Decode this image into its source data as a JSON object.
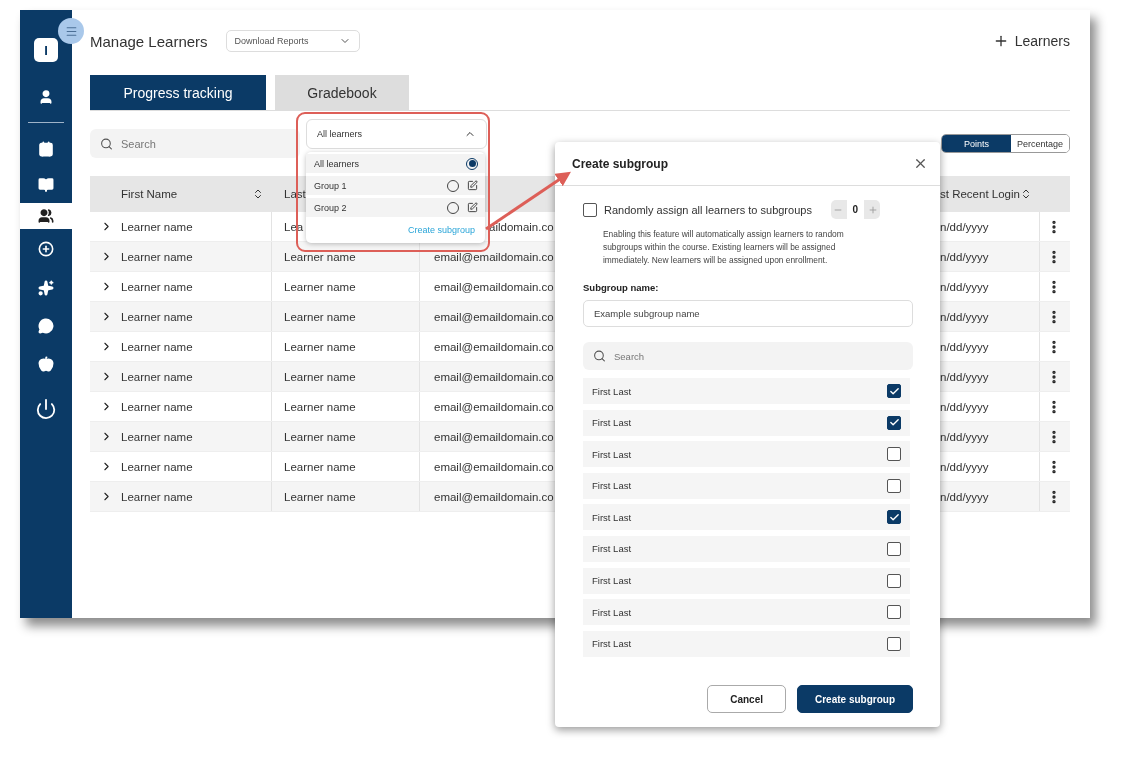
{
  "sidebar": {
    "logo": "I",
    "items": [
      {
        "selected": false
      },
      {
        "selected": false
      },
      {
        "selected": false
      },
      {
        "selected": true
      },
      {
        "selected": false
      },
      {
        "selected": false
      },
      {
        "selected": false
      },
      {
        "selected": false
      },
      {
        "selected": false
      }
    ]
  },
  "header": {
    "title": "Manage Learners",
    "reports_select": "Download Reports",
    "add_button": "Learners"
  },
  "tabs": [
    {
      "label": "Progress tracking",
      "selected": true
    },
    {
      "label": "Gradebook",
      "selected": false
    }
  ],
  "search": {
    "placeholder": "Search"
  },
  "filter": {
    "value": "All learners",
    "expanded": true,
    "options": [
      {
        "label": "All learners",
        "selected": true,
        "editable": false
      },
      {
        "label": "Group 1",
        "selected": false,
        "editable": true
      },
      {
        "label": "Group 2",
        "selected": false,
        "editable": true
      }
    ],
    "action": "Create subgroup"
  },
  "score_toggle": [
    {
      "label": "Points",
      "selected": true
    },
    {
      "label": "Percentage",
      "selected": false
    }
  ],
  "table": {
    "columns": [
      {
        "label": "First Name",
        "sortable": true
      },
      {
        "label": "Last",
        "sortable": false
      },
      {
        "sortable": false
      },
      {
        "label": "st Recent Login",
        "sortable": true
      }
    ],
    "rows": [
      {
        "expanded": false,
        "cells": [
          "Learner name",
          "Lea",
          "aildomain.co",
          "n/dd/yyyy"
        ]
      },
      {
        "expanded": false,
        "cells": [
          "Learner name",
          "Learner name",
          "email@emaildomain.co",
          "n/dd/yyyy"
        ]
      },
      {
        "expanded": false,
        "cells": [
          "Learner name",
          "Learner name",
          "email@emaildomain.co",
          "n/dd/yyyy"
        ]
      },
      {
        "expanded": false,
        "cells": [
          "Learner name",
          "Learner name",
          "email@emaildomain.co",
          "n/dd/yyyy"
        ]
      },
      {
        "expanded": false,
        "cells": [
          "Learner name",
          "Learner name",
          "email@emaildomain.co",
          "n/dd/yyyy"
        ]
      },
      {
        "expanded": false,
        "cells": [
          "Learner name",
          "Learner name",
          "email@emaildomain.co",
          "n/dd/yyyy"
        ]
      },
      {
        "expanded": false,
        "cells": [
          "Learner name",
          "Learner name",
          "email@emaildomain.co",
          "n/dd/yyyy"
        ]
      },
      {
        "expanded": false,
        "cells": [
          "Learner name",
          "Learner name",
          "email@emaildomain.co",
          "n/dd/yyyy"
        ]
      },
      {
        "expanded": false,
        "cells": [
          "Learner name",
          "Learner name",
          "email@emaildomain.co",
          "n/dd/yyyy"
        ]
      },
      {
        "expanded": false,
        "cells": [
          "Learner name",
          "Learner name",
          "email@emaildomain.co",
          "n/dd/yyyy"
        ]
      }
    ]
  },
  "dialog": {
    "title": "Create subgroup",
    "random_assign": {
      "label": "Randomly assign all learners to subgroups",
      "checked": false,
      "count": "0",
      "help": "Enabling this feature will automatically assign learners to random subgroups within the course. Existing learners will be assigned immediately. New learners will be assigned upon enrollment."
    },
    "name_label": "Subgroup name:",
    "name_placeholder": "Example subgroup name",
    "search_placeholder": "Search",
    "learners": [
      {
        "name": "First Last",
        "checked": true
      },
      {
        "name": "First Last",
        "checked": true
      },
      {
        "name": "First Last",
        "checked": false
      },
      {
        "name": "First Last",
        "checked": false
      },
      {
        "name": "First Last",
        "checked": true
      },
      {
        "name": "First Last",
        "checked": false
      },
      {
        "name": "First Last",
        "checked": false
      },
      {
        "name": "First Last",
        "checked": false
      },
      {
        "name": "First Last",
        "checked": false
      }
    ],
    "buttons": {
      "cancel": "Cancel",
      "submit": "Create subgroup"
    }
  }
}
